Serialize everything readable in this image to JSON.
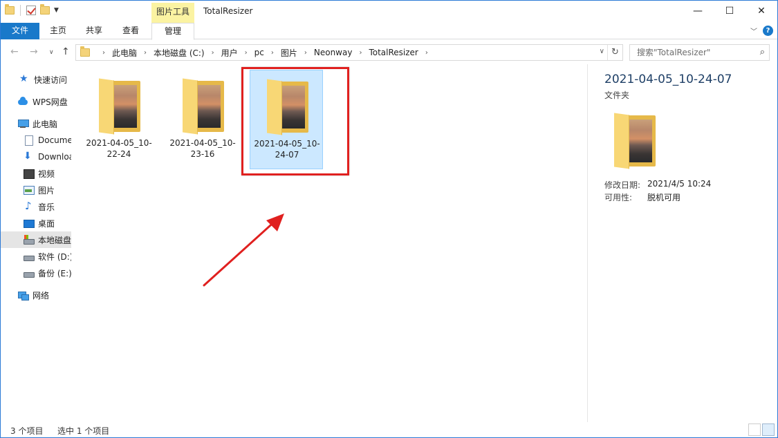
{
  "window": {
    "title": "TotalResizer",
    "contextual_tab_group": "图片工具",
    "controls": [
      "—",
      "☐",
      "✕"
    ]
  },
  "ribbon": {
    "tabs": [
      "文件",
      "主页",
      "共享",
      "查看",
      "管理"
    ]
  },
  "address": {
    "crumbs": [
      "此电脑",
      "本地磁盘 (C:)",
      "用户",
      "pc",
      "图片",
      "Neonway",
      "TotalResizer"
    ],
    "search_placeholder": "搜索\"TotalResizer\""
  },
  "nav": {
    "items": [
      {
        "label": "快速访问",
        "icon": "star-icon"
      },
      {
        "label": "WPS网盘",
        "icon": "cloud-icon"
      },
      {
        "label": "此电脑",
        "icon": "computer-icon"
      },
      {
        "label": "Docume",
        "icon": "document-icon"
      },
      {
        "label": "Downloa",
        "icon": "download-icon"
      },
      {
        "label": "视频",
        "icon": "video-icon"
      },
      {
        "label": "图片",
        "icon": "picture-icon"
      },
      {
        "label": "音乐",
        "icon": "music-icon"
      },
      {
        "label": "桌面",
        "icon": "desktop-icon"
      },
      {
        "label": "本地磁盘",
        "icon": "drive-c-icon"
      },
      {
        "label": "软件 (D:)",
        "icon": "drive-icon"
      },
      {
        "label": "备份 (E:)",
        "icon": "drive-icon"
      },
      {
        "label": "网络",
        "icon": "network-icon"
      }
    ]
  },
  "files": [
    {
      "line1": "2021-04-05_10-",
      "line2": "22-24",
      "selected": false
    },
    {
      "line1": "2021-04-05_10-",
      "line2": "23-16",
      "selected": false
    },
    {
      "line1": "2021-04-05_10-",
      "line2": "24-07",
      "selected": true
    }
  ],
  "preview": {
    "name": "2021-04-05_10-24-07",
    "type": "文件夹",
    "modified_label": "修改日期:",
    "modified_value": "2021/4/5 10:24",
    "availability_label": "可用性:",
    "availability_value": "脱机可用"
  },
  "status": {
    "count": "3 个项目",
    "selected": "选中 1 个项目"
  },
  "colors": {
    "accent": "#1979ca",
    "selection": "#cce8ff",
    "highlight": "#e0201f"
  }
}
